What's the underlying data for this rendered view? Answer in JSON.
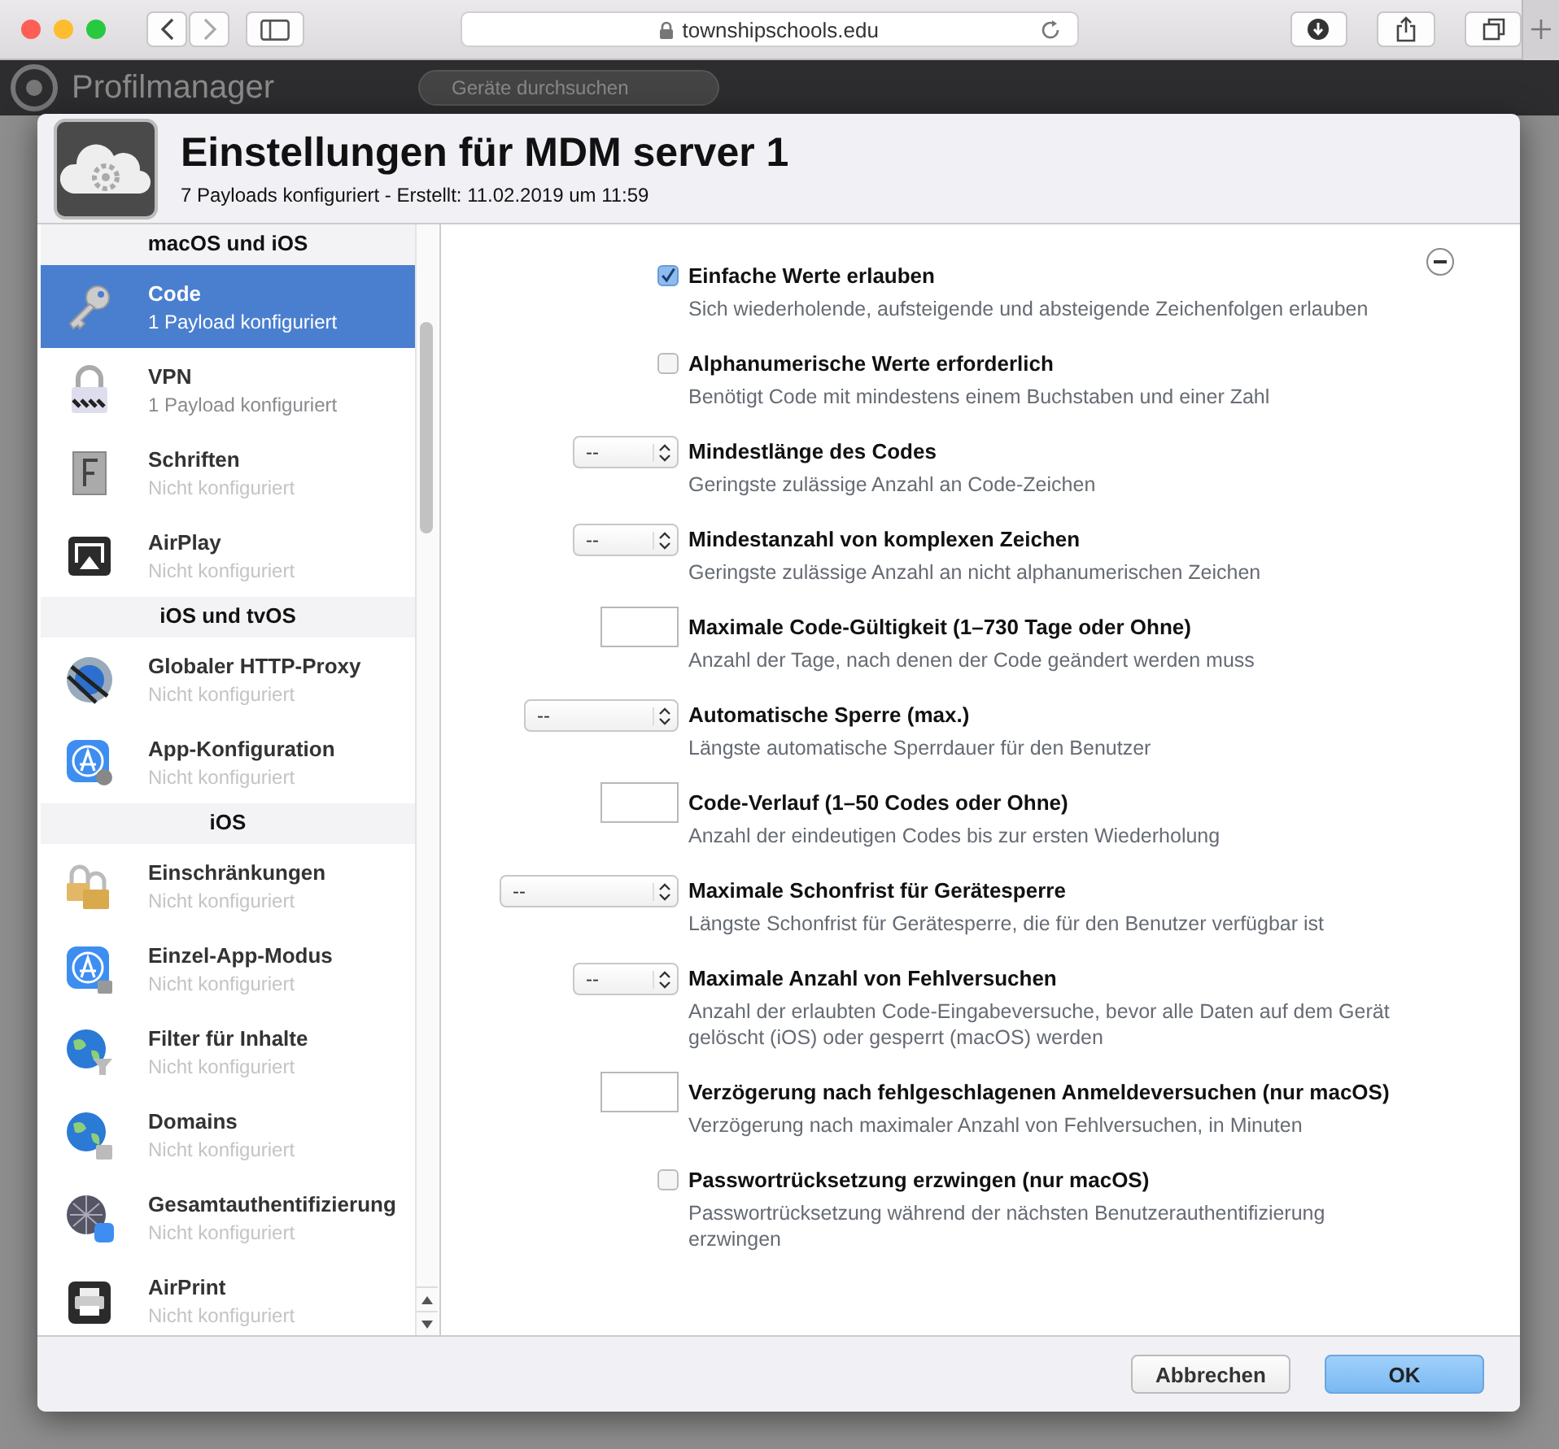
{
  "browser": {
    "url": "townshipschools.edu"
  },
  "app": {
    "title": "Profilmanager",
    "search": {
      "placeholder": "Geräte durchsuchen"
    }
  },
  "dialog": {
    "title": "Einstellungen für MDM server 1",
    "subtitle": "7 Payloads konfiguriert - Erstellt: 11.02.2019 um 11:59"
  },
  "sidebar": {
    "sections": [
      {
        "title": "macOS und iOS",
        "items": [
          {
            "name": "Code",
            "status": "1 Payload konfiguriert",
            "configured": true,
            "selected": true
          },
          {
            "name": "VPN",
            "status": "1 Payload konfiguriert",
            "configured": true,
            "selected": false
          },
          {
            "name": "Schriften",
            "status": "Nicht konfiguriert",
            "configured": false,
            "selected": false
          },
          {
            "name": "AirPlay",
            "status": "Nicht konfiguriert",
            "configured": false,
            "selected": false
          }
        ]
      },
      {
        "title": "iOS und tvOS",
        "items": [
          {
            "name": "Globaler HTTP-Proxy",
            "status": "Nicht konfiguriert",
            "configured": false,
            "selected": false
          },
          {
            "name": "App-Konfiguration",
            "status": "Nicht konfiguriert",
            "configured": false,
            "selected": false
          }
        ]
      },
      {
        "title": "iOS",
        "items": [
          {
            "name": "Einschränkungen",
            "status": "Nicht konfiguriert",
            "configured": false,
            "selected": false
          },
          {
            "name": "Einzel-App-Modus",
            "status": "Nicht konfiguriert",
            "configured": false,
            "selected": false
          },
          {
            "name": "Filter für Inhalte",
            "status": "Nicht konfiguriert",
            "configured": false,
            "selected": false
          },
          {
            "name": "Domains",
            "status": "Nicht konfiguriert",
            "configured": false,
            "selected": false
          },
          {
            "name": "Gesamtauthentifizierung",
            "status": "Nicht konfiguriert",
            "configured": false,
            "selected": false
          },
          {
            "name": "AirPrint",
            "status": "Nicht konfiguriert",
            "configured": false,
            "selected": false
          }
        ]
      }
    ]
  },
  "settings": [
    {
      "kind": "checkbox",
      "checked": true,
      "label": "Einfache Werte erlauben",
      "description": "Sich wiederholende, aufsteigende und absteigende Zeichenfolgen erlauben"
    },
    {
      "kind": "checkbox",
      "checked": false,
      "label": "Alphanumerische Werte erforderlich",
      "description": "Benötigt Code mit mindestens einem Buchstaben und einer Zahl"
    },
    {
      "kind": "select",
      "value": "--",
      "label": "Mindestlänge des Codes",
      "description": "Geringste zulässige Anzahl an Code-Zeichen"
    },
    {
      "kind": "select",
      "value": "--",
      "label": "Mindestanzahl von komplexen Zeichen",
      "description": "Geringste zulässige Anzahl an nicht alphanumerischen Zeichen"
    },
    {
      "kind": "input",
      "label": "Maximale Code-Gültigkeit (1–730 Tage oder Ohne)",
      "description": "Anzahl der Tage, nach denen der Code geändert werden muss"
    },
    {
      "kind": "select",
      "value": "--",
      "label": "Automatische Sperre (max.)",
      "description": "Längste automatische Sperrdauer für den Benutzer"
    },
    {
      "kind": "input",
      "label": "Code-Verlauf (1–50 Codes oder Ohne)",
      "description": "Anzahl der eindeutigen Codes bis zur ersten Wiederholung"
    },
    {
      "kind": "select",
      "value": "--",
      "label": "Maximale Schonfrist für Gerätesperre",
      "description": "Längste Schonfrist für Gerätesperre, die für den Benutzer verfügbar ist"
    },
    {
      "kind": "select",
      "value": "--",
      "label": "Maximale Anzahl von Fehlversuchen",
      "description": "Anzahl der erlaubten Code-Eingabeversuche, bevor alle Daten auf dem Gerät gelöscht (iOS) oder gesperrt (macOS) werden"
    },
    {
      "kind": "input",
      "label": "Verzögerung nach fehlgeschlagenen Anmeldeversuchen (nur macOS)",
      "description": "Verzögerung nach maximaler Anzahl von Fehlversuchen, in Minuten"
    },
    {
      "kind": "checkbox",
      "checked": false,
      "label": "Passwortrücksetzung erzwingen (nur macOS)",
      "description": "Passwortrücksetzung während der nächsten Benutzerauthentifizierung erzwingen"
    }
  ],
  "buttons": [
    {
      "label": "Abbrechen",
      "primary": false
    },
    {
      "label": "OK",
      "primary": true
    }
  ]
}
